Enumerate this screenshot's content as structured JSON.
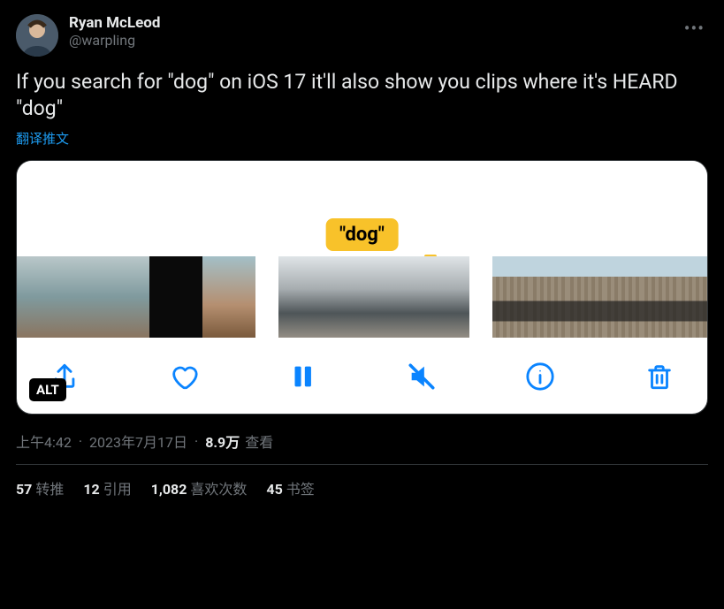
{
  "header": {
    "display_name": "Ryan McLeod",
    "handle": "@warpling"
  },
  "body": "If you search for \"dog\" on iOS 17 it'll also show you clips where it's HEARD \"dog\"",
  "translate_label": "翻译推文",
  "media": {
    "keyword_pill": "\"dog\"",
    "alt_badge": "ALT",
    "toolbar_icons": [
      "share",
      "like",
      "pause",
      "mute",
      "info",
      "trash"
    ]
  },
  "meta": {
    "time": "上午4:42",
    "date": "2023年7月17日",
    "views_count": "8.9万",
    "views_label": "查看"
  },
  "stats": {
    "retweets": {
      "count": "57",
      "label": "转推"
    },
    "quotes": {
      "count": "12",
      "label": "引用"
    },
    "likes": {
      "count": "1,082",
      "label": "喜欢次数"
    },
    "bookmarks": {
      "count": "45",
      "label": "书签"
    }
  }
}
